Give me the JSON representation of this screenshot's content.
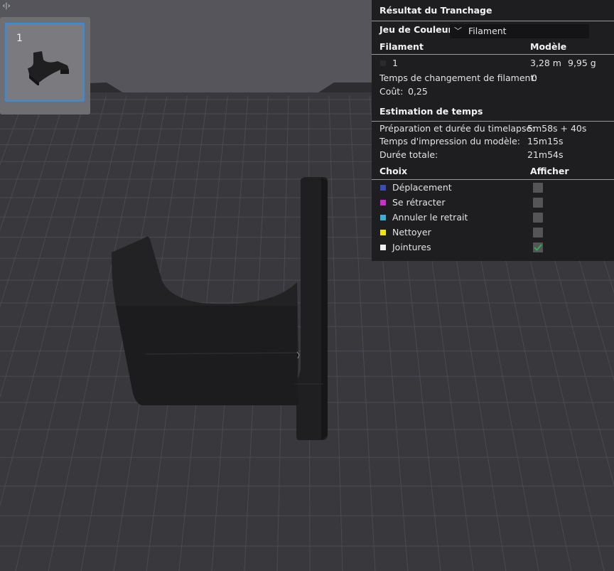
{
  "viewport": {
    "toggle_glyph": "‹|›",
    "plate_index": "1"
  },
  "panel": {
    "title": "Résultat du Tranchage",
    "color_scheme_label": "Jeu de Couleur",
    "color_scheme_value": "Filament",
    "filament_header": "Filament",
    "model_header": "Modèle",
    "filament_rows": [
      {
        "index": "1",
        "length": "3,28 m",
        "weight": "9,95 g",
        "color": "#2b2b2e"
      }
    ],
    "filament_change_label": "Temps de changement de filament:",
    "filament_change_value": "0",
    "cost_label": "Coût:",
    "cost_value": "0,25",
    "time_header": "Estimation de temps",
    "prep_label": "Préparation et durée du timelapse:",
    "prep_value": "5m58s + 40s",
    "print_label": "Temps d'impression du modèle:",
    "print_value": "15m15s",
    "total_label": "Durée totale:",
    "total_value": "21m54s",
    "choice_header": "Choix",
    "show_header": "Afficher",
    "options": [
      {
        "label": "Déplacement",
        "color": "#3b4bb8",
        "checked": false
      },
      {
        "label": "Se rétracter",
        "color": "#d22ad2",
        "checked": false
      },
      {
        "label": "Annuler le retrait",
        "color": "#3ab0d6",
        "checked": false
      },
      {
        "label": "Nettoyer",
        "color": "#f2e600",
        "checked": false
      },
      {
        "label": "Jointures",
        "color": "#f0f0f0",
        "checked": true
      }
    ]
  }
}
